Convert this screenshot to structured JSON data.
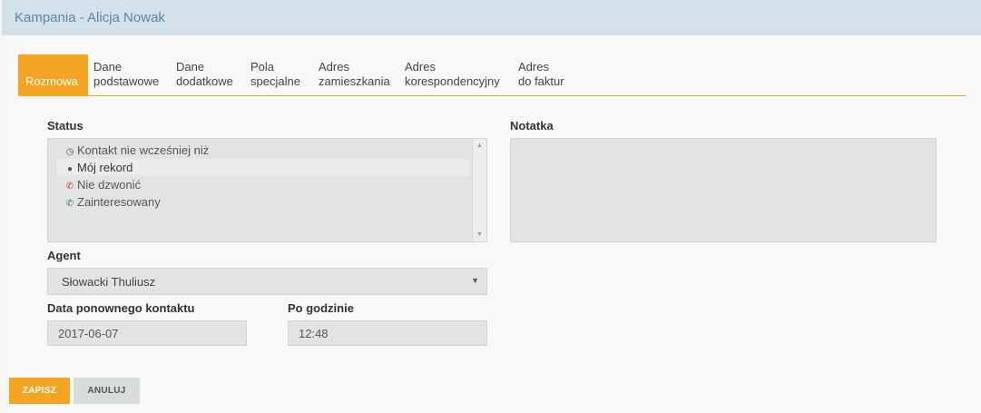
{
  "header": {
    "title": "Kampania - Alicja Nowak"
  },
  "tabs": [
    {
      "line1": "Rozmowa",
      "line2": "",
      "active": true
    },
    {
      "line1": "Dane",
      "line2": "podstawowe"
    },
    {
      "line1": "Dane",
      "line2": "dodatkowe"
    },
    {
      "line1": "Pola",
      "line2": "specjalne"
    },
    {
      "line1": "Adres",
      "line2": "zamieszkania"
    },
    {
      "line1": "Adres",
      "line2": "korespondencyjny"
    },
    {
      "line1": "Adres",
      "line2": "do faktur"
    }
  ],
  "status": {
    "label": "Status",
    "options": [
      {
        "label": "Kontakt nie wcześniej niż",
        "icon": "clock-icon",
        "color": "#555555"
      },
      {
        "label": "Mój rekord",
        "icon": "user-icon",
        "color": "#555555",
        "selected": true
      },
      {
        "label": "Nie dzwonić",
        "icon": "phone-hangup-icon",
        "color": "#d9322b"
      },
      {
        "label": "Zainteresowany",
        "icon": "phone-icon",
        "color": "#2e8b2e"
      }
    ]
  },
  "note": {
    "label": "Notatka",
    "value": ""
  },
  "agent": {
    "label": "Agent",
    "value": "Słowacki Thuliusz"
  },
  "callback": {
    "label": "Data ponownego kontaktu",
    "value": "2017-06-07"
  },
  "after_hour": {
    "label": "Po godzinie",
    "value": "12:48"
  },
  "buttons": {
    "save": "ZAPISZ",
    "cancel": "ANULUJ"
  },
  "colors": {
    "accent": "#f5a524",
    "header_bg": "#d3e1ea",
    "title": "#5c86a5"
  }
}
